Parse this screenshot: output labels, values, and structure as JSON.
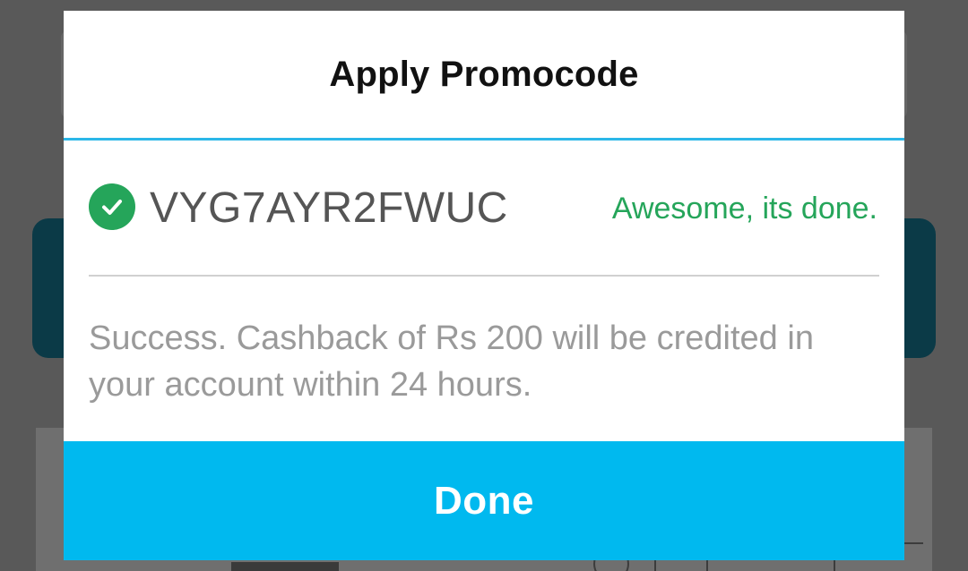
{
  "dialog": {
    "title": "Apply Promocode",
    "promo": {
      "code": "VYG7AYR2FWUC",
      "status": "Awesome, its done.",
      "status_icon": "check-circle-icon",
      "status_color": "#25a55a"
    },
    "message": "Success. Cashback of Rs 200 will be credited in your account within 24 hours.",
    "done_button": {
      "label": "Done",
      "color": "#00b9ef"
    },
    "header_divider_color": "#2cb7e8"
  }
}
